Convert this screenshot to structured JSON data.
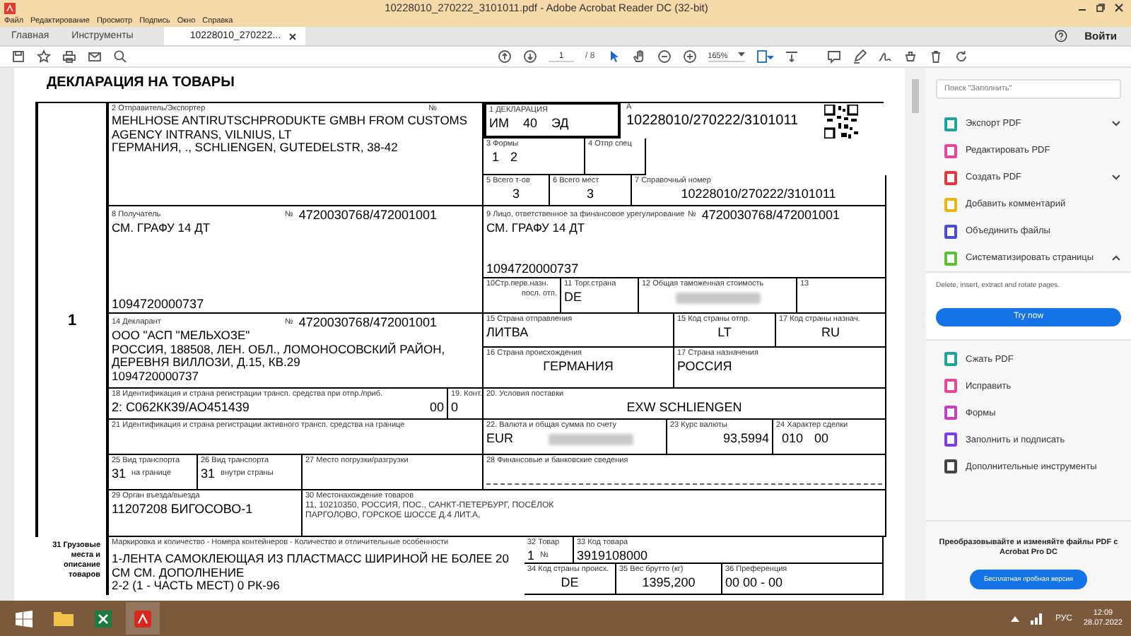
{
  "window": {
    "title": "10228010_270222_3101011.pdf - Adobe Acrobat Reader DC (32-bit)"
  },
  "menu": [
    "Файл",
    "Редактирование",
    "Просмотр",
    "Подпись",
    "Окно",
    "Справка"
  ],
  "tabs": [
    {
      "label": "Главная",
      "selected": false
    },
    {
      "label": "Инструменты",
      "selected": false
    },
    {
      "label": "10228010_270222...",
      "selected": true
    }
  ],
  "signin": "Войти",
  "toolbar": {
    "page": "1",
    "pages": "/ 8",
    "zoom": "165%"
  },
  "document": {
    "title": "ДЕКЛАРАЦИЯ НА ТОВАРЫ",
    "sheet_number": "1",
    "box2": {
      "label": "2 Отправитель/Экспортер",
      "number_label": "№",
      "lines": [
        "MEHLHOSE ANTIRUTSCHPRODUKTE GMBH FROM CUSTOMS AGENCY INTRANS, VILNIUS, LT",
        "ГЕРМАНИЯ, ., SCHLIENGEN, GUTEDELSTR, 38-42"
      ]
    },
    "box1": {
      "label": "1 ДЕКЛАРАЦИЯ",
      "values": [
        "ИМ",
        "40",
        "ЭД"
      ]
    },
    "box_a": {
      "label": "А",
      "value": "10228010/270222/3101011"
    },
    "box3": {
      "label": "3 Формы",
      "values": [
        "1",
        "2"
      ]
    },
    "box4": {
      "label": "4 Отпр спец"
    },
    "box5": {
      "label": "5 Всего т-ов",
      "value": "3"
    },
    "box6": {
      "label": "6 Всего мест",
      "value": "3"
    },
    "box7": {
      "label": "7 Справочный номер",
      "value": "10228010/270222/3101011"
    },
    "box8": {
      "label": "8 Получатель",
      "number_label": "№",
      "number": "4720030768/472001001",
      "lines": [
        "СМ. ГРАФУ 14 ДТ"
      ],
      "ogrn": "1094720000737"
    },
    "box9": {
      "label": "9 Лицо, ответственное за финансовое урегулирование",
      "number_label": "№",
      "number": "4720030768/472001001",
      "lines": [
        "СМ. ГРАФУ 14 ДТ"
      ],
      "ogrn": "1094720000737"
    },
    "box10": {
      "label": "10Стр.перв.назн.",
      "sublabel": "посл. отп."
    },
    "box11": {
      "label": "11 Торг.страна",
      "value": "DE"
    },
    "box12": {
      "label": "12 Общая таможенная стоимость"
    },
    "box13": {
      "label": "13"
    },
    "box14": {
      "label": "14 Декларант",
      "number_label": "№",
      "number": "4720030768/472001001",
      "lines": [
        "ООО \"АСП \"МЕЛЬХОЗЕ\"",
        "РОССИЯ, 188508, ЛЕН. ОБЛ., ЛОМОНОСОВСКИЙ РАЙОН,",
        "ДЕРЕВНЯ ВИЛЛОЗИ, Д.15, КВ.29",
        "1094720000737"
      ]
    },
    "box15": {
      "label": "15 Страна отправления",
      "value": "ЛИТВА"
    },
    "box15a": {
      "label": "15 Код страны отпр.",
      "value": "LT"
    },
    "box17a": {
      "label": "17 Код страны назнач.",
      "value": "RU"
    },
    "box16": {
      "label": "16 Страна происхождения",
      "value": "ГЕРМАНИЯ"
    },
    "box17": {
      "label": "17 Страна назначения",
      "value": "РОССИЯ"
    },
    "box18": {
      "label": "18 Идентификация и страна регистрации трансп. средства при отпр./приб.",
      "value": "2: С062КК39/АО451439",
      "code": "00"
    },
    "box19": {
      "label": "19. Конт.",
      "value": "0"
    },
    "box20": {
      "label": "20. Условия поставки",
      "value": "EXW SCHLIENGEN"
    },
    "box21": {
      "label": "21 Идентификация и страна регистрации активного трансп. средства  на границе"
    },
    "box22": {
      "label": "22. Валюта и общая сумма по счету",
      "value": "EUR"
    },
    "box23": {
      "label": "23 Курс валюты",
      "value": "93,5994"
    },
    "box24": {
      "label": "24 Характер сделки",
      "values": [
        "010",
        "00"
      ]
    },
    "box25": {
      "label": "25 Вид транспорта",
      "value": "31",
      "sublabel": "на границе"
    },
    "box26": {
      "label": "26 Вид транспорта",
      "value": "31",
      "sublabel": "внутри страны"
    },
    "box27": {
      "label": "27 Место погрузки/разгрузки"
    },
    "box28": {
      "label": "28 Финансовые и банковские сведения"
    },
    "box29": {
      "label": "29 Орган въезда/выезда",
      "value": "11207208 БИГОСОВО-1"
    },
    "box30": {
      "label": "30 Местонахождение товаров",
      "lines": [
        "11, 10210350, РОССИЯ, ПОС., САНКТ-ПЕТЕРБУРГ, ПОСЁЛОК",
        "ПАРГОЛОВО, ГОРСКОЕ ШОССЕ Д.4 ЛИТ.А,"
      ]
    },
    "box31": {
      "side_label": "31 Грузовые места и описание товаров",
      "label": "Маркировка и количество - Номера контейнеров - Количество и отличительные особенности",
      "lines": [
        "1-ЛЕНТА САМОКЛЕЮЩАЯ ИЗ ПЛАСТМАСС ШИРИНОЙ НЕ БОЛЕЕ 20",
        "СМ СМ. ДОПОЛНЕНИЕ",
        "2-2 (1 - ЧАСТЬ МЕСТ) 0 РК-96"
      ]
    },
    "box32": {
      "label": "32 Товар",
      "value": "1",
      "sublabel": "№"
    },
    "box33": {
      "label": "33 Код товара",
      "value": "3919108000"
    },
    "box34": {
      "label": "34 Код страны происх.",
      "value": "DE"
    },
    "box35": {
      "label": "35 Вес брутто (кг)",
      "value": "1395,200"
    },
    "box36": {
      "label": "36 Преференция",
      "value": "00 00 - 00"
    }
  },
  "tools": {
    "search_placeholder": "Поиск \"Заполнить\"",
    "items": [
      {
        "label": "Экспорт PDF",
        "color": "#1fa39a",
        "kind": "expandable",
        "expanded": false
      },
      {
        "label": "Редактировать PDF",
        "color": "#e8469b",
        "kind": "plain"
      },
      {
        "label": "Создать PDF",
        "color": "#e0383e",
        "kind": "expandable",
        "expanded": false
      },
      {
        "label": "Добавить комментарий",
        "color": "#e8b70f",
        "kind": "plain"
      },
      {
        "label": "Объединить файлы",
        "color": "#4b4bd8",
        "kind": "plain"
      },
      {
        "label": "Систематизировать страницы",
        "color": "#5fbf35",
        "kind": "expandable",
        "expanded": true,
        "description": "Delete, insert, extract and rotate pages.",
        "action": "Try now"
      },
      {
        "label": "Сжать PDF",
        "color": "#1fa39a",
        "kind": "plain"
      },
      {
        "label": "Исправить",
        "color": "#e8469b",
        "kind": "plain"
      },
      {
        "label": "Формы",
        "color": "#c43fc6",
        "kind": "plain"
      },
      {
        "label": "Заполнить и подписать",
        "color": "#7b3fe4",
        "kind": "plain"
      },
      {
        "label": "Дополнительные инструменты",
        "color": "#444444",
        "kind": "plain"
      }
    ],
    "promo": "Преобразовывайте и изменяйте файлы PDF с Acrobat Pro DC",
    "promo_button": "Бесплатная пробная версия"
  },
  "taskbar": {
    "language": "РУС",
    "time": "12:09",
    "date": "28.07.2022"
  }
}
